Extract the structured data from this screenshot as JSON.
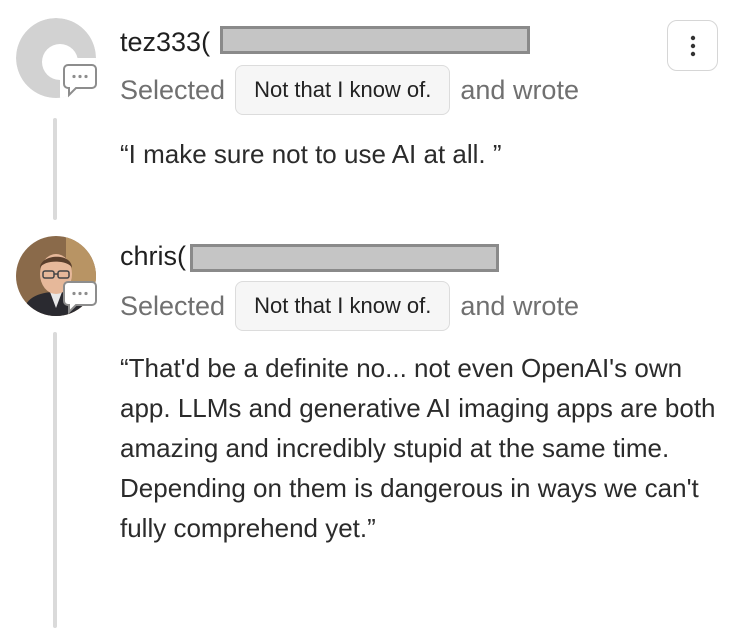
{
  "comments": [
    {
      "username": "tez333(",
      "avatar": "default-avatar-icon",
      "selected_label": "Selected",
      "choice": "Not that I know of.",
      "wrote_label": "and wrote",
      "text": "“I make sure not to use AI at all. ”",
      "has_menu": true
    },
    {
      "username": "chris(",
      "avatar": "user-photo",
      "selected_label": "Selected",
      "choice": "Not that I know of.",
      "wrote_label": "and wrote",
      "text": "“That'd be a definite no... not even OpenAI's own app. LLMs and generative AI imaging apps are both amazing and incredibly stupid at the same time. Depending on them is dangerous in ways we can't fully comprehend yet.”",
      "has_menu": false
    }
  ],
  "colors": {
    "thread_line": "#dadada",
    "chip_background": "#f6f6f6",
    "muted_text": "#707070",
    "redaction": "#c5c5c5"
  }
}
